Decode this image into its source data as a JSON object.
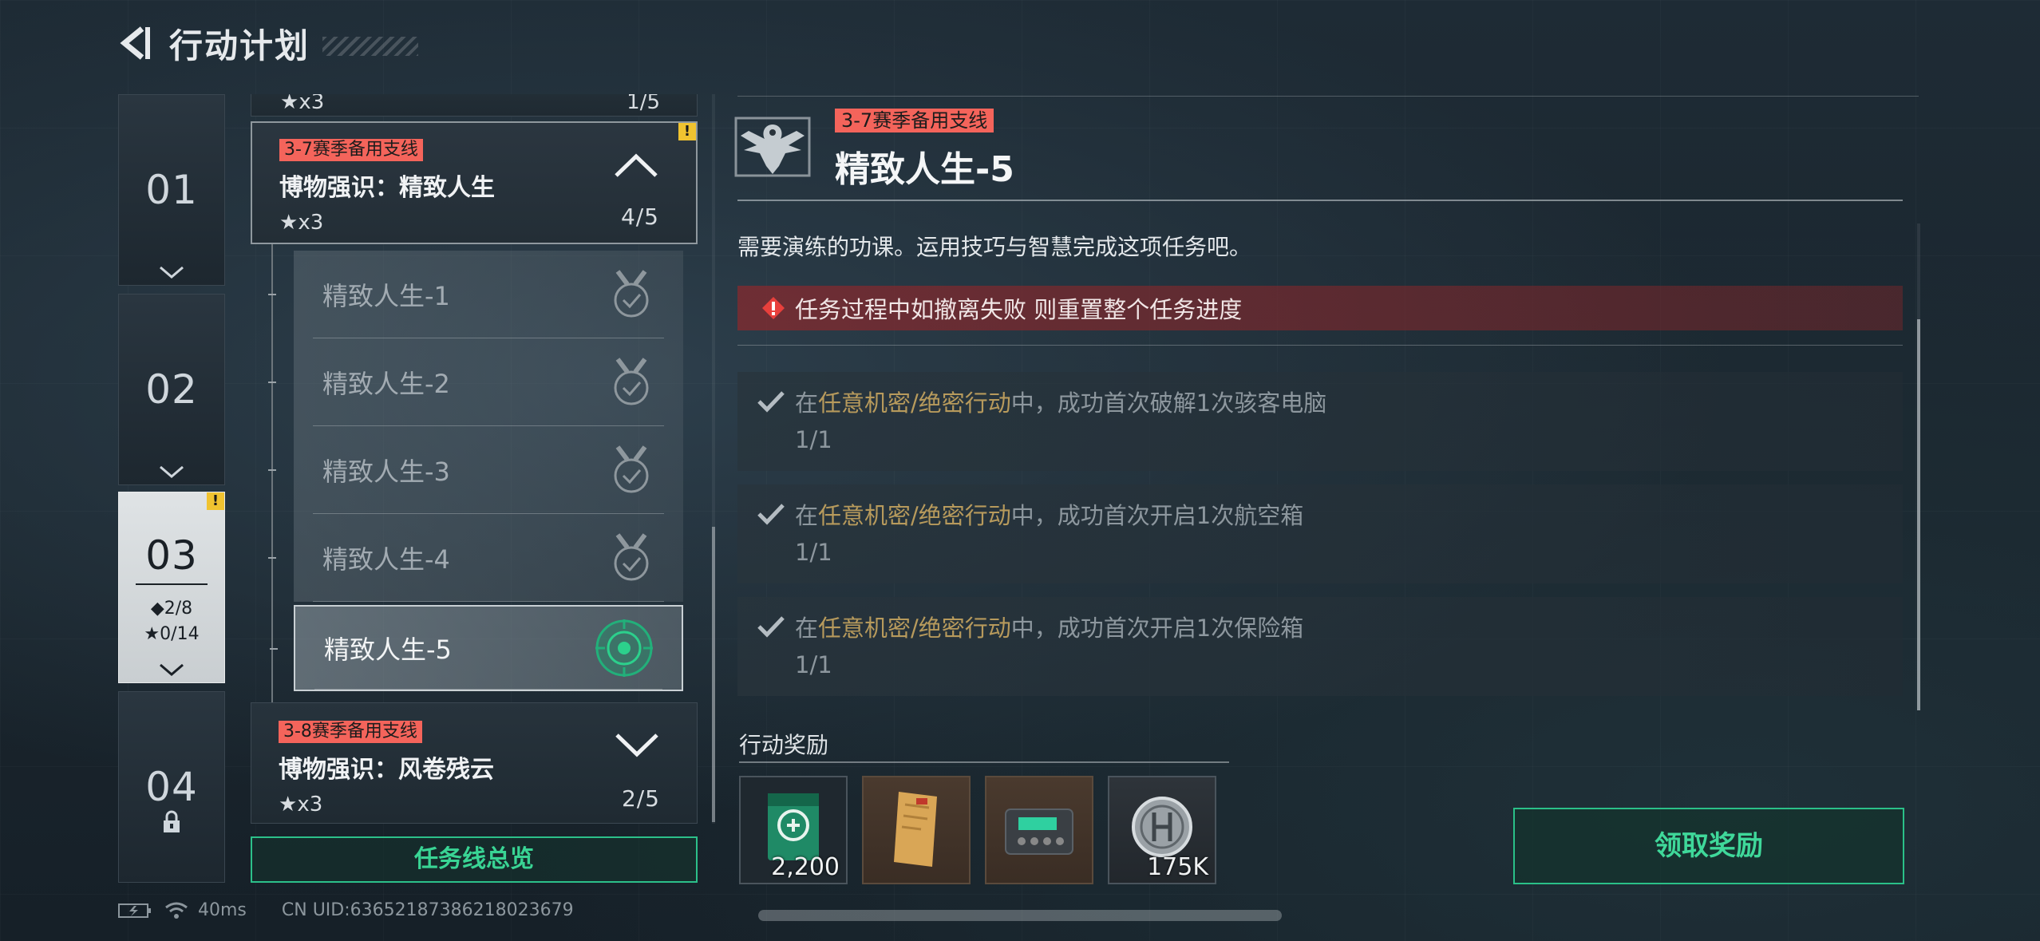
{
  "header": {
    "title": "行动计划"
  },
  "chapters": [
    {
      "num": "01"
    },
    {
      "num": "02"
    },
    {
      "num": "03",
      "diamond_stat": "2/8",
      "star_stat": "0/14",
      "warn": "!"
    },
    {
      "num": "04"
    }
  ],
  "missions": {
    "partial_top": {
      "stars": "x3",
      "progress": "1/5"
    },
    "expanded": {
      "tag": "3-7赛季备用支线",
      "name": "博物强识：精致人生",
      "stars": "x3",
      "progress": "4/5",
      "warn": "!",
      "sub_items": [
        {
          "label": "精致人生-1",
          "state": "done"
        },
        {
          "label": "精致人生-2",
          "state": "done"
        },
        {
          "label": "精致人生-3",
          "state": "done"
        },
        {
          "label": "精致人生-4",
          "state": "done"
        },
        {
          "label": "精致人生-5",
          "state": "active"
        }
      ]
    },
    "next": {
      "tag": "3-8赛季备用支线",
      "name": "博物强识：风卷残云",
      "stars": "x3",
      "progress": "2/5"
    },
    "overview_button": "任务线总览"
  },
  "detail": {
    "tag": "3-7赛季备用支线",
    "title": "精致人生-5",
    "description": "需要演练的功课。运用技巧与智慧完成这项任务吧。",
    "warning": "任务过程中如撤离失败 则重置整个任务进度",
    "objectives": [
      {
        "prefix": "在",
        "highlight": "任意机密/绝密行动",
        "suffix": "中，成功首次破解1次骇客电脑",
        "count": "1/1"
      },
      {
        "prefix": "在",
        "highlight": "任意机密/绝密行动",
        "suffix": "中，成功首次开启1次航空箱",
        "count": "1/1"
      },
      {
        "prefix": "在",
        "highlight": "任意机密/绝密行动",
        "suffix": "中，成功首次开启1次保险箱",
        "count": "1/1"
      }
    ]
  },
  "rewards": {
    "label": "行动奖励",
    "items": [
      {
        "icon": "green-card-icon",
        "qty": "2,200"
      },
      {
        "icon": "document-icon",
        "qty": ""
      },
      {
        "icon": "device-icon",
        "qty": ""
      },
      {
        "icon": "coin-icon",
        "qty": "175K"
      }
    ],
    "claim_button": "领取奖励"
  },
  "status_bar": {
    "ping": "40ms",
    "uid": "CN UID:636521873862180236​79"
  },
  "colors": {
    "accent_green": "#39d494",
    "tag_red": "#f4645b",
    "highlight_gold": "#b79a5c",
    "warning_red": "#8c282c"
  }
}
